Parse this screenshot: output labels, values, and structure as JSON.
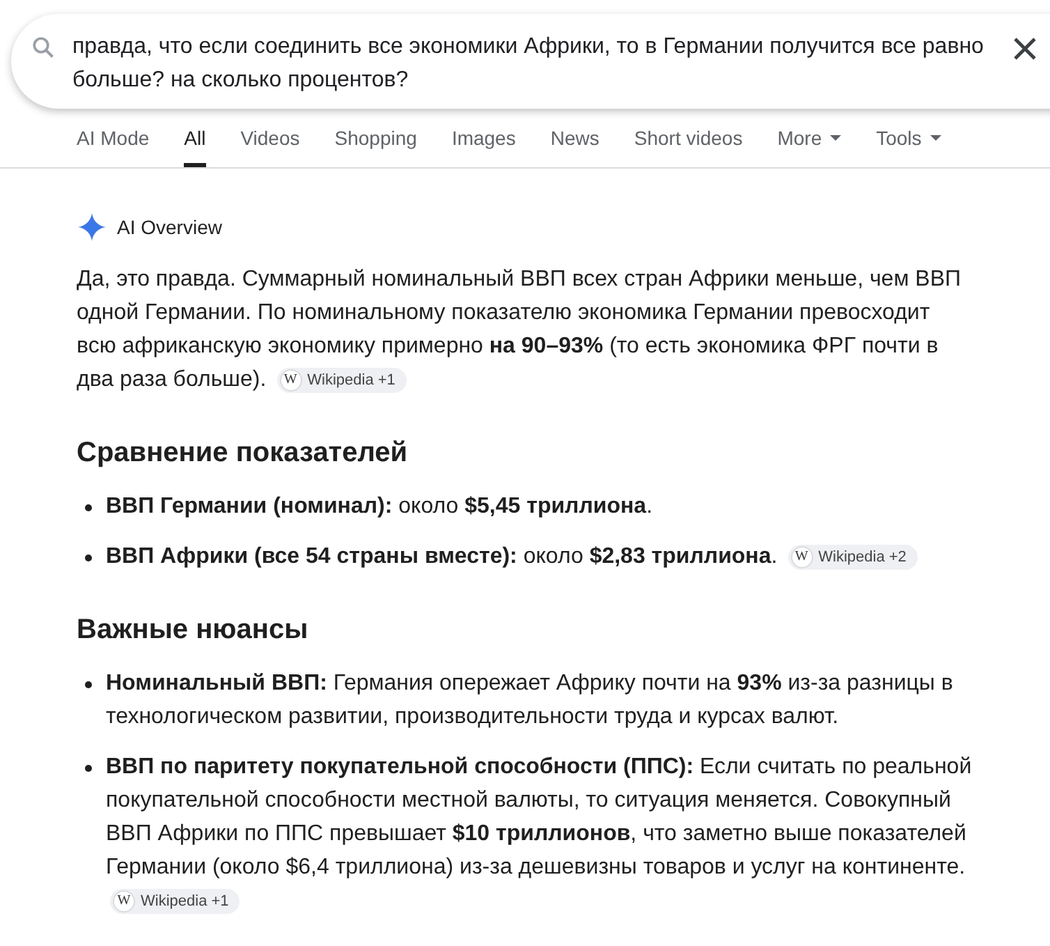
{
  "search": {
    "query": "правда, что если соединить все экономики Африки, то в Германии получится все равно больше? на сколько процентов?"
  },
  "tabs": [
    {
      "label": "AI Mode",
      "selected": false,
      "dropdown": false
    },
    {
      "label": "All",
      "selected": true,
      "dropdown": false
    },
    {
      "label": "Videos",
      "selected": false,
      "dropdown": false
    },
    {
      "label": "Shopping",
      "selected": false,
      "dropdown": false
    },
    {
      "label": "Images",
      "selected": false,
      "dropdown": false
    },
    {
      "label": "News",
      "selected": false,
      "dropdown": false
    },
    {
      "label": "Short videos",
      "selected": false,
      "dropdown": false
    },
    {
      "label": "More",
      "selected": false,
      "dropdown": true
    },
    {
      "label": "Tools",
      "selected": false,
      "dropdown": true
    }
  ],
  "overview": {
    "title": "AI Overview",
    "intro": {
      "text": "Да, это правда. Суммарный номинальный ВВП всех стран Африки меньше, чем ВВП одной Германии. По номинальному показателю экономика Германии превосходит всю африканскую экономику примерно **на 90–93%** (то есть экономика ФРГ почти в два раза больше).",
      "source": {
        "icon_letter": "W",
        "label": "Wikipedia +1"
      }
    },
    "sections": [
      {
        "heading": "Сравнение показателей",
        "items": [
          {
            "text": "**ВВП Германии (номинал):** около **$5,45 триллиона**."
          },
          {
            "text": "**ВВП Африки (все 54 страны вместе):** около **$2,83 триллиона**.",
            "source": {
              "icon_letter": "W",
              "label": "Wikipedia +2"
            }
          }
        ]
      },
      {
        "heading": "Важные нюансы",
        "items": [
          {
            "text": "**Номинальный ВВП:** Германия опережает Африку почти на **93%** из-за разницы в технологическом развитии, производительности труда и курсах валют."
          },
          {
            "text": "**ВВП по паритету покупательной способности (ППС):** Если считать по реальной покупательной способности местной валюты, то ситуация меняется. Совокупный ВВП Африки по ППС превышает **$10 триллионов**, что заметно выше показателей Германии (около $6,4 триллиона) из-за дешевизны товаров и услуг на континенте.",
            "source": {
              "icon_letter": "W",
              "label": "Wikipedia +1"
            }
          }
        ]
      }
    ]
  }
}
